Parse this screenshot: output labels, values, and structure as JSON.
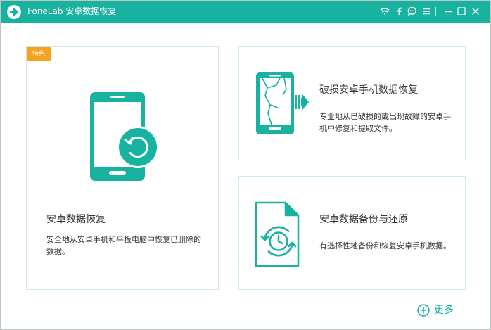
{
  "app": {
    "name": "FoneLab",
    "subtitle": "安卓数据恢复",
    "accent_color": "#17b2a0",
    "badge_color": "#f6a21e"
  },
  "titlebar_icons": [
    "wifi-icon",
    "facebook-icon",
    "chat-icon",
    "menu-icon",
    "minimize-icon",
    "maximize-icon",
    "close-icon"
  ],
  "cards": {
    "android_data_recovery": {
      "badge": "特色",
      "title": "安卓数据恢复",
      "description": "安全地从安卓手机和平板电脑中恢复已删除的数据。",
      "icon": "phone-restore-icon"
    },
    "broken_android_recovery": {
      "title": "破损安卓手机数据恢复",
      "description": "专业地从已破损的或出现故障的安卓手机中修复和提取文件。",
      "icon": "broken-phone-icon"
    },
    "backup_restore": {
      "title": "安卓数据备份与还原",
      "description": "有选择性地备份和恢复安卓手机数据。",
      "icon": "document-backup-icon"
    }
  },
  "more": {
    "label": "更多",
    "icon": "plus-circle-icon"
  }
}
